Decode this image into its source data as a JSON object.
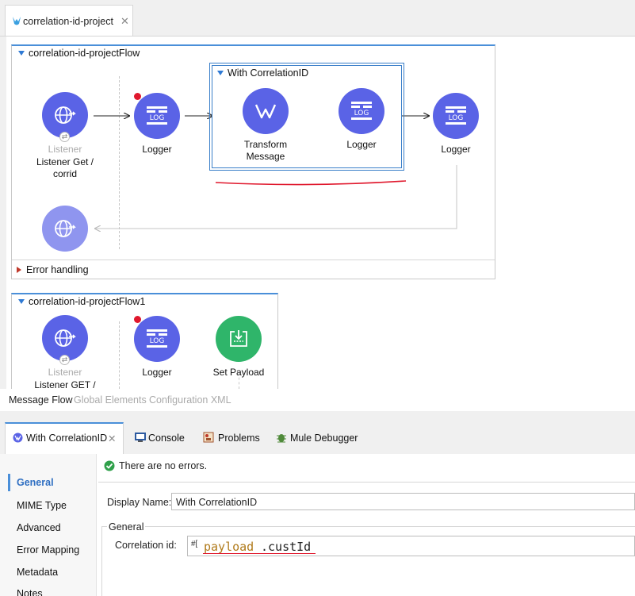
{
  "editor_tab": {
    "title": "correlation-id-project"
  },
  "flow1": {
    "title": "correlation-id-projectFlow",
    "listener": {
      "type_label": "Listener",
      "name_line1": "Listener Get /",
      "name_line2": "corrid"
    },
    "logger1": "Logger",
    "scope": {
      "title": "With CorrelationID",
      "transform_line1": "Transform",
      "transform_line2": "Message",
      "logger": "Logger"
    },
    "logger3": "Logger",
    "error_handling": "Error handling"
  },
  "flow2": {
    "title": "correlation-id-projectFlow1",
    "listener": {
      "type_label": "Listener",
      "name_line1": "Listener GET /"
    },
    "logger": "Logger",
    "set_payload": "Set Payload"
  },
  "canvas_tabs": [
    "Message Flow",
    "Global Elements",
    "Configuration XML"
  ],
  "view_tabs": {
    "active": "With CorrelationID",
    "console": "Console",
    "problems": "Problems",
    "debugger": "Mule Debugger"
  },
  "sidebar": [
    "General",
    "MIME Type",
    "Advanced",
    "Error Mapping",
    "Metadata",
    "Notes"
  ],
  "status": "There are no errors.",
  "form": {
    "display_name_label": "Display Name:",
    "display_name_value": "With CorrelationID",
    "group_label": "General",
    "correlation_label": "Correlation id:",
    "expr_prefix": "#[",
    "expr_keyword": "payload",
    "expr_rest": ".custId"
  },
  "colors": {
    "node": "#5a63e6",
    "node_light": "#8f95ef",
    "set_payload": "#2fb56a",
    "accent": "#4a8fd9",
    "annotation_red": "#e0182d"
  }
}
